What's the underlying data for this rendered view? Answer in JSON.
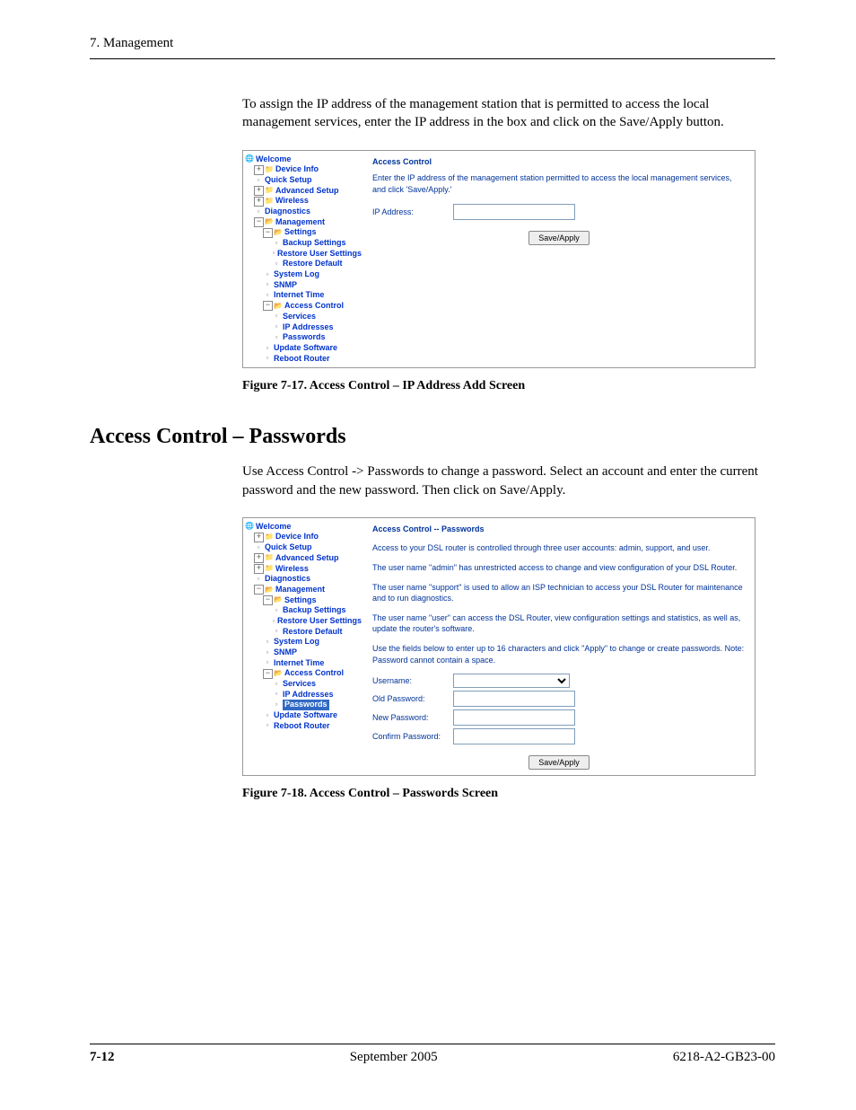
{
  "page_header": "7. Management",
  "intro1": "To assign the IP address of the management station that is permitted to access the local management services, enter the IP address in the box and click on the Save/Apply button.",
  "fig17": {
    "nav": {
      "welcome": "Welcome",
      "device_info": "Device Info",
      "quick_setup": "Quick Setup",
      "advanced_setup": "Advanced Setup",
      "wireless": "Wireless",
      "diagnostics": "Diagnostics",
      "management": "Management",
      "settings": "Settings",
      "backup": "Backup Settings",
      "restore_user": "Restore User Settings",
      "restore_default": "Restore Default",
      "system_log": "System Log",
      "snmp": "SNMP",
      "internet_time": "Internet Time",
      "access_control": "Access Control",
      "services": "Services",
      "ip_addresses": "IP Addresses",
      "passwords": "Passwords",
      "update_software": "Update Software",
      "reboot_router": "Reboot Router"
    },
    "content": {
      "title": "Access Control",
      "desc": "Enter the IP address of the management station permitted to access the local management services, and click 'Save/Apply.'",
      "ip_label": "IP Address:",
      "button": "Save/Apply"
    },
    "caption": "Figure 7-17.   Access Control – IP Address Add Screen"
  },
  "section2_title": "Access Control – Passwords",
  "intro2": "Use Access Control -> Passwords to change a password. Select an account and enter the current password and the new password. Then click on Save/Apply.",
  "fig18": {
    "nav": {
      "welcome": "Welcome",
      "device_info": "Device Info",
      "quick_setup": "Quick Setup",
      "advanced_setup": "Advanced Setup",
      "wireless": "Wireless",
      "diagnostics": "Diagnostics",
      "management": "Management",
      "settings": "Settings",
      "backup": "Backup Settings",
      "restore_user": "Restore User Settings",
      "restore_default": "Restore Default",
      "system_log": "System Log",
      "snmp": "SNMP",
      "internet_time": "Internet Time",
      "access_control": "Access Control",
      "services": "Services",
      "ip_addresses": "IP Addresses",
      "passwords": "Passwords",
      "update_software": "Update Software",
      "reboot_router": "Reboot Router"
    },
    "content": {
      "title": "Access Control -- Passwords",
      "p1": "Access to your DSL router is controlled through three user accounts: admin, support, and user.",
      "p2": "The user name \"admin\" has unrestricted access to change and view configuration of your DSL Router.",
      "p3": "The user name \"support\" is used to allow an ISP technician to access your DSL Router for maintenance and to run diagnostics.",
      "p4": "The user name \"user\" can access the DSL Router, view configuration settings and statistics, as well as, update the router's software.",
      "p5": "Use the fields below to enter up to 16 characters and click \"Apply\" to change or create passwords. Note: Password cannot contain a space.",
      "username": "Username:",
      "old_pw": "Old Password:",
      "new_pw": "New Password:",
      "confirm_pw": "Confirm Password:",
      "button": "Save/Apply"
    },
    "caption": "Figure 7-18.   Access Control – Passwords Screen"
  },
  "footer": {
    "page": "7-12",
    "mid": "September 2005",
    "right": "6218-A2-GB23-00"
  }
}
